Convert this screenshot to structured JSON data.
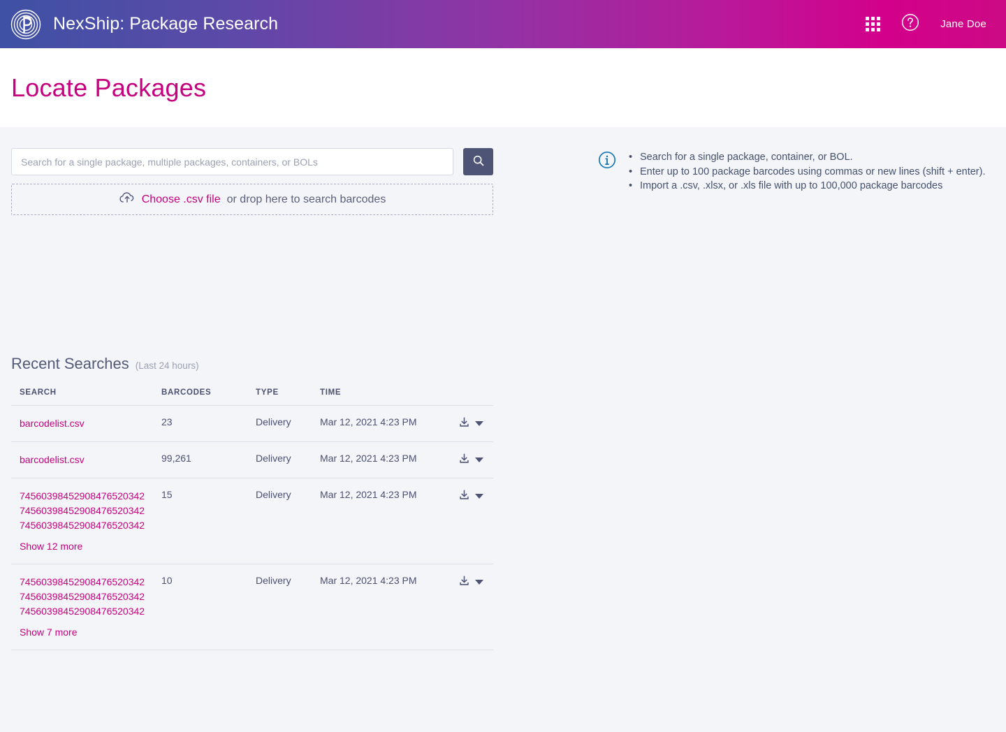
{
  "topbar": {
    "logo_icon": "pitney-bowes-circular-p-logo",
    "brand_title": "NexShip: Package Research",
    "apps_icon": "app-grid-icon",
    "help_icon": "help-circle-icon",
    "user_name": "Jane Doe",
    "gradient_start": "#3e51a4",
    "gradient_mid": "#8e35a5",
    "gradient_end": "#cc0a85"
  },
  "page": {
    "title": "Locate Packages",
    "title_color": "#c6017f",
    "background": "#f4f5f9"
  },
  "search": {
    "placeholder": "Search for a single package, multiple packages, containers, or BOLs",
    "value": "",
    "button_icon": "search-icon",
    "button_color": "#4d5475"
  },
  "dropzone": {
    "upload_icon": "cloud-upload-icon",
    "link_label": "Choose .csv file",
    "text": "or drop here to search barcodes"
  },
  "info": {
    "icon": "info-circle-icon",
    "icon_color": "#1676b8",
    "items": [
      "Search for a single package, container, or BOL.",
      "Enter up to 100 package barcodes using commas or new lines (shift + enter).",
      "Import a .csv, .xlsx, or .xls file with up to 100,000 package barcodes"
    ]
  },
  "recent": {
    "title": "Recent Searches",
    "subtitle": "(Last 24 hours)",
    "columns": [
      "SEARCH",
      "BARCODES",
      "TYPE",
      "TIME",
      ""
    ],
    "download_icon": "download-icon",
    "caret_icon": "caret-down-icon",
    "rows": [
      {
        "search_items": [
          "barcodelist.csv"
        ],
        "show_more": "",
        "barcodes": "23",
        "type": "Delivery",
        "time": "Mar 12, 2021 4:23 PM"
      },
      {
        "search_items": [
          "barcodelist.csv"
        ],
        "show_more": "",
        "barcodes": "99,261",
        "type": "Delivery",
        "time": "Mar 12, 2021 4:23 PM"
      },
      {
        "search_items": [
          "74560398452908476520342",
          "74560398452908476520342",
          "74560398452908476520342"
        ],
        "show_more": "Show 12 more",
        "barcodes": "15",
        "type": "Delivery",
        "time": "Mar 12, 2021 4:23 PM"
      },
      {
        "search_items": [
          "74560398452908476520342",
          "74560398452908476520342",
          "74560398452908476520342"
        ],
        "show_more": "Show 7 more",
        "barcodes": "10",
        "type": "Delivery",
        "time": "Mar 12, 2021 4:23 PM"
      }
    ]
  }
}
